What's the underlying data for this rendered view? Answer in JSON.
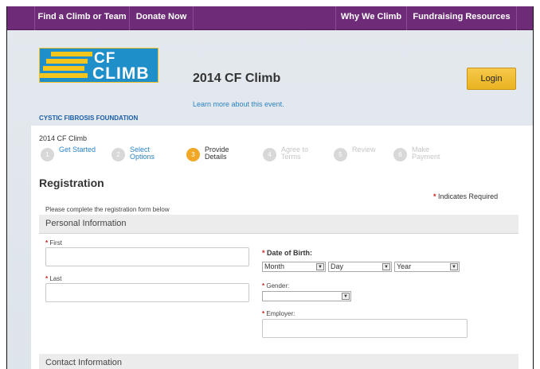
{
  "nav": {
    "find": "Find a Climb or Team",
    "donate": "Donate Now",
    "why": "Why We Climb",
    "resources": "Fundraising Resources"
  },
  "logo": {
    "line1": "CF",
    "line2": "CLIMB",
    "subtitle": "CYSTIC FIBROSIS FOUNDATION",
    "colors": {
      "blue": "#1f8fc9",
      "yellow": "#f4c51c"
    }
  },
  "event": {
    "title": "2014 CF Climb",
    "learn_more": "Learn more about this event."
  },
  "login": "Login",
  "breadcrumb": "2014 CF Climb",
  "steps": [
    {
      "num": "1",
      "label": "Get Started",
      "state": "done"
    },
    {
      "num": "2",
      "label": "Select Options",
      "state": "done"
    },
    {
      "num": "3",
      "label": "Provide Details",
      "state": "active"
    },
    {
      "num": "4",
      "label": "Agree to Terms",
      "state": "disabled"
    },
    {
      "num": "5",
      "label": "Review",
      "state": "disabled"
    },
    {
      "num": "6",
      "label": "Make Payment",
      "state": "disabled"
    }
  ],
  "registration": {
    "title": "Registration",
    "required_note": "Indicates Required",
    "intro": "Please complete the registration form below"
  },
  "personal": {
    "heading": "Personal Information",
    "first_label": "First",
    "last_label": "Last",
    "dob_label": "Date of Birth:",
    "month": "Month",
    "day": "Day",
    "year": "Year",
    "gender_label": "Gender:",
    "gender_value": "",
    "employer_label": "Employer:"
  },
  "contact": {
    "heading": "Contact Information"
  },
  "theme": {
    "nav_purple": "#6e2c78",
    "accent_orange": "#f0a826",
    "link_blue": "#2b82c4",
    "required_red": "#d02020"
  }
}
